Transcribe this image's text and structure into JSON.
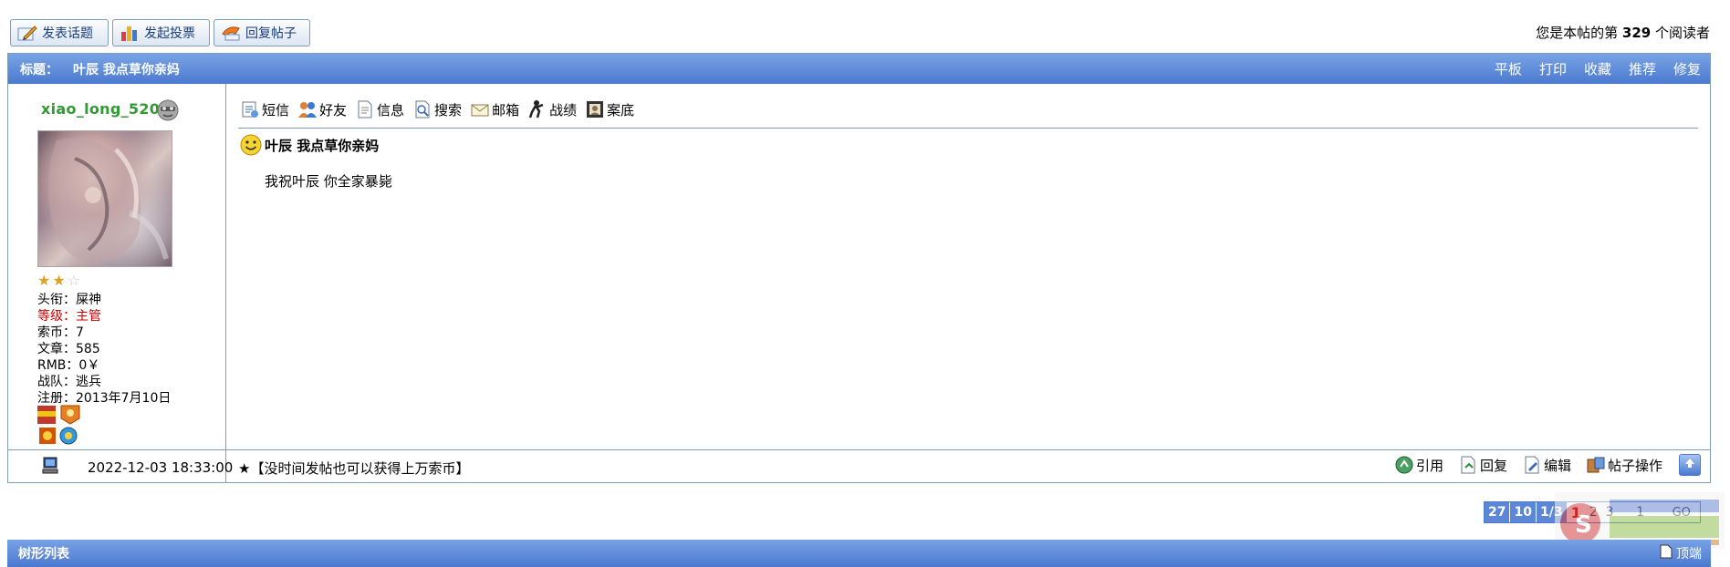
{
  "toolbar": {
    "new_topic": "发表话题",
    "new_poll": "发起投票",
    "reply_post": "回复帖子"
  },
  "reader_count": {
    "prefix": "您是本帖的第",
    "count": "329",
    "suffix": "个阅读者"
  },
  "post_header": {
    "title_label": "标题：",
    "title_text": "叶辰 我点草你亲妈",
    "links": [
      "平板",
      "打印",
      "收藏",
      "推荐",
      "修复"
    ]
  },
  "user": {
    "name": "xiao_long_520",
    "stars_filled": 2,
    "stars_total": 3,
    "info": {
      "title_label": "头衔：",
      "title_value": "屎神",
      "rank_label": "等级：",
      "rank_value": "主管",
      "coins_label": "索币：",
      "coins_value": "7",
      "posts_label": "文章：",
      "posts_value": "585",
      "rmb_label": "RMB：",
      "rmb_value": "0￥",
      "team_label": "战队：",
      "team_value": "逃兵",
      "reg_label": "注册：",
      "reg_value": "2013年7月10日"
    }
  },
  "actions": {
    "sms": "短信",
    "friend": "好友",
    "info": "信息",
    "search": "搜索",
    "mail": "邮箱",
    "record": "战绩",
    "file": "案底"
  },
  "post": {
    "title": "叶辰 我点草你亲妈",
    "body": "我祝叶辰 你全家暴毙"
  },
  "footer": {
    "date": "2022-12-03 18:33:00",
    "signature": "★【没时间发帖也可以获得上万索币】",
    "quote": "引用",
    "reply": "回复",
    "edit": "编辑",
    "post_ops": "帖子操作"
  },
  "pager": {
    "total": "27",
    "per_page": "10",
    "pages": "1/3",
    "current": "1",
    "page2": "2",
    "page3": "3",
    "jump_value": "1",
    "go": "GO"
  },
  "bottom_bar": {
    "title": "树形列表",
    "right_label": "顶端"
  },
  "colors": {
    "header_blue": "#4b79cf",
    "border": "#7f9db9",
    "username_green": "#339933",
    "rank_red": "#cc0000"
  }
}
